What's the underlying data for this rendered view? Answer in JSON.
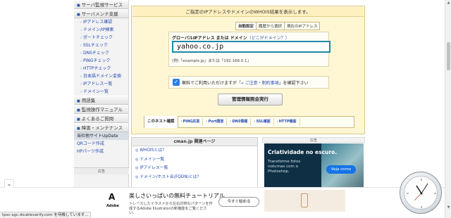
{
  "sidebar": {
    "items": [
      {
        "kind": "head",
        "label": "サーバ監視サービス"
      },
      {
        "kind": "head",
        "label": "サーバメンテ支援"
      },
      {
        "kind": "sub",
        "label": "IPアドレス確認"
      },
      {
        "kind": "sub",
        "label": "ドメイン/IP検索"
      },
      {
        "kind": "sub",
        "label": "ポートチェック"
      },
      {
        "kind": "sub",
        "label": "SSLチェック"
      },
      {
        "kind": "sub",
        "label": "DNSチェック"
      },
      {
        "kind": "sub",
        "label": "PINGチェック"
      },
      {
        "kind": "sub",
        "label": "HTTPチェック"
      },
      {
        "kind": "sub",
        "label": "日本語ドメイン変換"
      },
      {
        "kind": "sub",
        "label": "IPアドレス一覧"
      },
      {
        "kind": "sub",
        "label": "ドメイン一覧"
      },
      {
        "kind": "head",
        "label": "用語集"
      },
      {
        "kind": "head",
        "label": "監視操作マニュアル"
      },
      {
        "kind": "head",
        "label": "よくあるご質問"
      },
      {
        "kind": "head",
        "label": "障害・メンテナンス"
      },
      {
        "kind": "plain",
        "label": "当社他サイトUpDate",
        "active": true
      },
      {
        "kind": "plain",
        "label": "QRコード作成"
      },
      {
        "kind": "plain",
        "label": "HPパーツ作成"
      }
    ],
    "ad_label": "広告"
  },
  "main": {
    "title": "ご指定のIPアドレスやドメインのWHOIS結果を表示します。",
    "tabs": [
      {
        "label": "自動設定",
        "active": true
      },
      {
        "label": "履歴から選択"
      },
      {
        "label": "現在のIPアドレス"
      }
    ],
    "form": {
      "label": "グローバルIPアドレス または ドメイン",
      "help_link": "（どこがドメイン？）",
      "input_value": "yahoo.co.jp",
      "example": "(例)「example.jp」または「192.168.0.1」"
    },
    "terms": {
      "checked": true,
      "pre_text": "無料でご利用いただけますが「",
      "link_text": "ご注意・制約事項",
      "post_text": "」を確認下さい"
    },
    "submit_label": "管理情報照会実行",
    "net_check": {
      "label": "このネスト確認",
      "links": [
        "PING応答",
        "Port開放",
        "DNS情報",
        "SSL確認",
        "HTTP確認"
      ]
    }
  },
  "related": {
    "title": "cman.jp 関連ページ",
    "items": [
      "WHOISとは？",
      "ドメイン一覧",
      "IPアドレス一覧",
      "ドメイン/ホスト名(FQDN)とは？"
    ]
  },
  "ad_right": {
    "label": "広告",
    "headline": "Criatividade no escuro.",
    "body": "Transforme fotos noturnas com o Photoshop.",
    "cta": "Veja como"
  },
  "bottom_ad": {
    "collapse_icon": "chevron-down-icon",
    "brand": "Adobe",
    "title": "楽しさいっぱいの無料チュートリアル",
    "desc": "トレースしたイラストから左右対称なパターンを作成するAdobe Illustratorの新機能をご覧ください。",
    "cta": "今すぐ始める"
  },
  "status_text": "tpsc-sgc.doubleverify.com を待機しています..."
}
